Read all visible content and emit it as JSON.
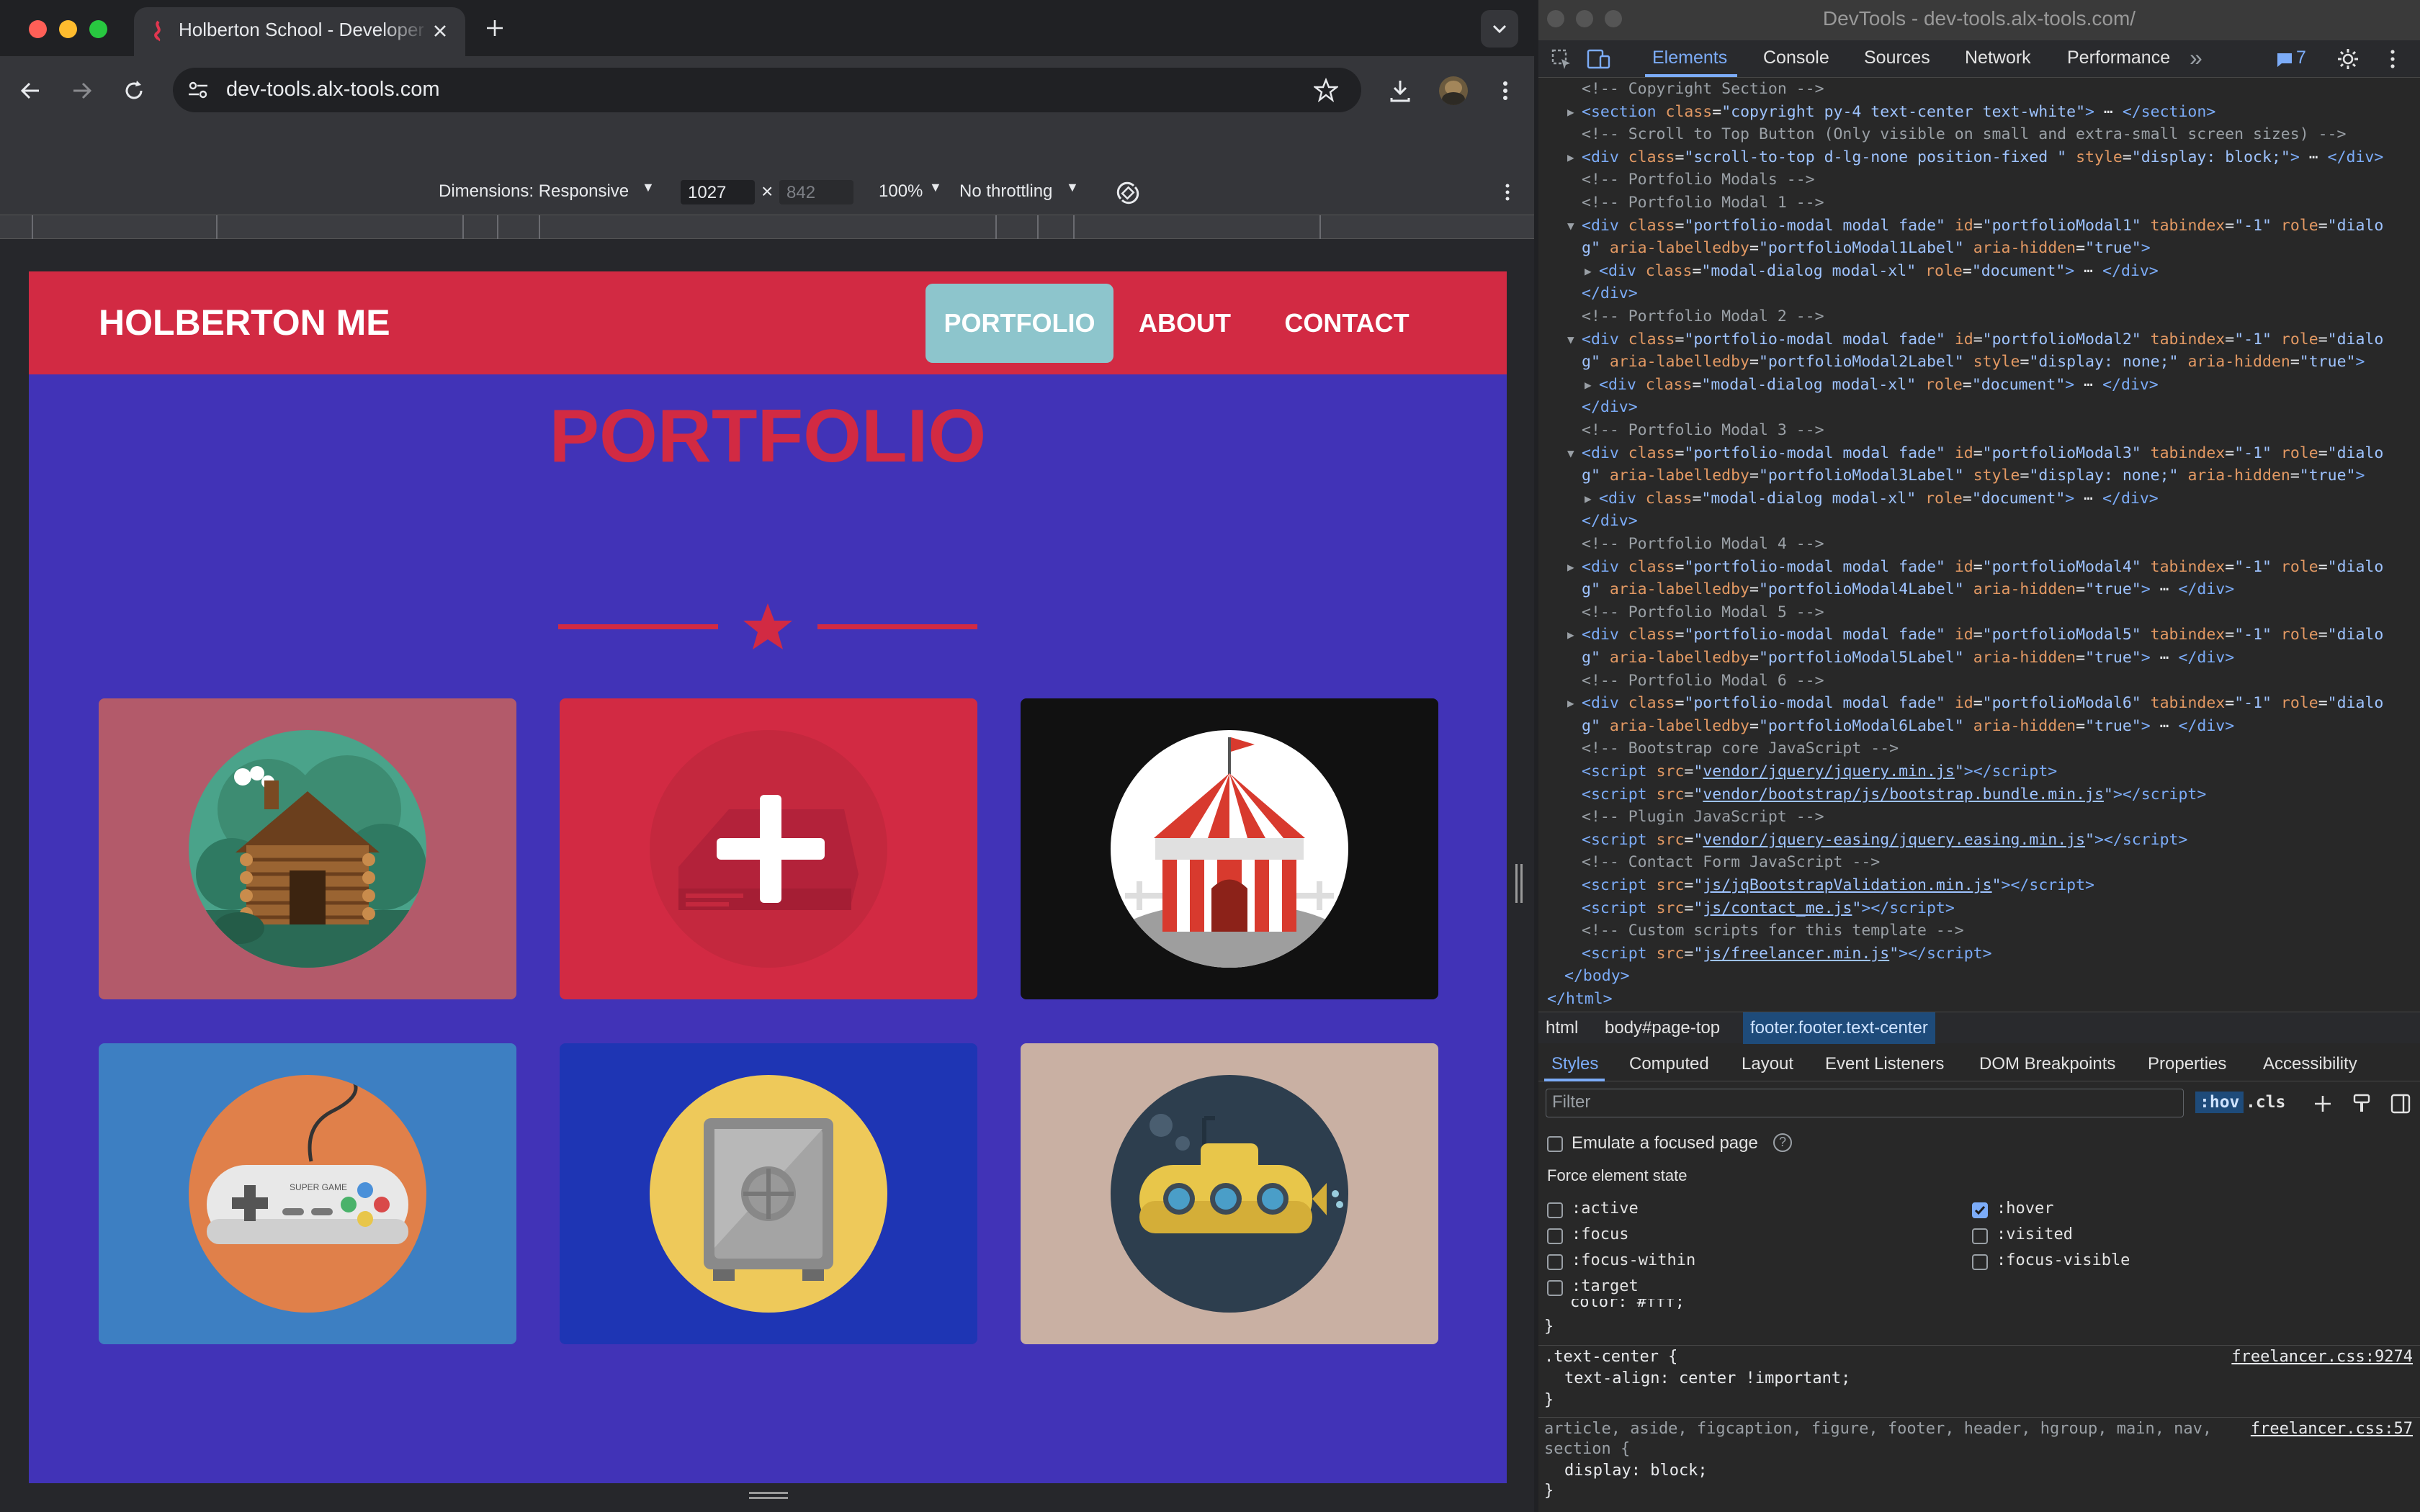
{
  "browser": {
    "tab_title": "Holberton School - Developer",
    "url": "dev-tools.alx-tools.com",
    "emulation": {
      "dimensions_label": "Dimensions: Responsive",
      "width": "1027",
      "times": "×",
      "height": "842",
      "zoom": "100%",
      "throttling": "No throttling"
    }
  },
  "site": {
    "brand": "HOLBERTON ME",
    "nav": [
      "PORTFOLIO",
      "ABOUT",
      "CONTACT"
    ],
    "section_title": "PORTFOLIO",
    "items": [
      {
        "icon": "cabin-icon",
        "bg": "#b35a6a"
      },
      {
        "icon": "life-saver-plus-icon",
        "bg": "#d22a43"
      },
      {
        "icon": "circus-tent-icon",
        "bg": "#111111"
      },
      {
        "icon": "game-controller-icon",
        "bg": "#3d7fc2"
      },
      {
        "icon": "safe-icon",
        "bg": "#1e35b4"
      },
      {
        "icon": "submarine-icon",
        "bg": "#c9b0a3"
      }
    ],
    "colors": {
      "primary": "#d22a43",
      "bg": "#4133b7",
      "nav_active": "#8dc5cc"
    }
  },
  "devtools": {
    "window_title": "DevTools - dev-tools.alx-tools.com/",
    "tabs": [
      "Elements",
      "Console",
      "Sources",
      "Network",
      "Performance"
    ],
    "issues_count": "7",
    "code_lines": [
      {
        "indent": 1,
        "arrow": "",
        "html": "<span class='cm'>&lt;!-- Copyright Section --&gt;</span>"
      },
      {
        "indent": 1,
        "arrow": "▶",
        "html": "<span class='tag'>&lt;section</span> <span class='an'>class</span>=<span class='av'>\"copyright py-4 text-center text-white\"</span><span class='tag'>&gt;</span> ⋯ <span class='tag'>&lt;/section&gt;</span>"
      },
      {
        "indent": 1,
        "arrow": "",
        "html": "<span class='cm'>&lt;!-- Scroll to Top Button (Only visible on small and extra-small screen sizes) --&gt;</span>"
      },
      {
        "indent": 1,
        "arrow": "▶",
        "html": "<span class='tag'>&lt;div</span> <span class='an'>class</span>=<span class='av'>\"scroll-to-top d-lg-none position-fixed \"</span> <span class='an'>style</span>=<span class='av'>\"display: block;\"</span><span class='tag'>&gt;</span> ⋯ <span class='tag'>&lt;/div&gt;</span>"
      },
      {
        "indent": 1,
        "arrow": "",
        "html": "<span class='cm'>&lt;!-- Portfolio Modals --&gt;</span>"
      },
      {
        "indent": 1,
        "arrow": "",
        "html": "<span class='cm'>&lt;!-- Portfolio Modal 1 --&gt;</span>"
      },
      {
        "indent": 1,
        "arrow": "▼",
        "html": "<span class='tag'>&lt;div</span> <span class='an'>class</span>=<span class='av'>\"portfolio-modal modal fade\"</span> <span class='an'>id</span>=<span class='av'>\"portfolioModal1\"</span> <span class='an'>tabindex</span>=<span class='av'>\"-1\"</span> <span class='an'>role</span>=<span class='av'>\"dialo</span>"
      },
      {
        "indent": 1,
        "arrow": "",
        "html": "<span class='av'>g\"</span> <span class='an'>aria-labelledby</span>=<span class='av'>\"portfolioModal1Label\"</span> <span class='an'>aria-hidden</span>=<span class='av'>\"true\"</span><span class='tag'>&gt;</span>"
      },
      {
        "indent": 2,
        "arrow": "▶",
        "html": "<span class='tag'>&lt;div</span> <span class='an'>class</span>=<span class='av'>\"modal-dialog modal-xl\"</span> <span class='an'>role</span>=<span class='av'>\"document\"</span><span class='tag'>&gt;</span> ⋯ <span class='tag'>&lt;/div&gt;</span>"
      },
      {
        "indent": 1,
        "arrow": "",
        "html": "<span class='tag'>&lt;/div&gt;</span>"
      },
      {
        "indent": 1,
        "arrow": "",
        "html": "<span class='cm'>&lt;!-- Portfolio Modal 2 --&gt;</span>"
      },
      {
        "indent": 1,
        "arrow": "▼",
        "html": "<span class='tag'>&lt;div</span> <span class='an'>class</span>=<span class='av'>\"portfolio-modal modal fade\"</span> <span class='an'>id</span>=<span class='av'>\"portfolioModal2\"</span> <span class='an'>tabindex</span>=<span class='av'>\"-1\"</span> <span class='an'>role</span>=<span class='av'>\"dialo</span>"
      },
      {
        "indent": 1,
        "arrow": "",
        "html": "<span class='av'>g\"</span> <span class='an'>aria-labelledby</span>=<span class='av'>\"portfolioModal2Label\"</span> <span class='an'>style</span>=<span class='av'>\"display: none;\"</span> <span class='an'>aria-hidden</span>=<span class='av'>\"true\"</span><span class='tag'>&gt;</span>"
      },
      {
        "indent": 2,
        "arrow": "▶",
        "html": "<span class='tag'>&lt;div</span> <span class='an'>class</span>=<span class='av'>\"modal-dialog modal-xl\"</span> <span class='an'>role</span>=<span class='av'>\"document\"</span><span class='tag'>&gt;</span> ⋯ <span class='tag'>&lt;/div&gt;</span>"
      },
      {
        "indent": 1,
        "arrow": "",
        "html": "<span class='tag'>&lt;/div&gt;</span>"
      },
      {
        "indent": 1,
        "arrow": "",
        "html": "<span class='cm'>&lt;!-- Portfolio Modal 3 --&gt;</span>"
      },
      {
        "indent": 1,
        "arrow": "▼",
        "html": "<span class='tag'>&lt;div</span> <span class='an'>class</span>=<span class='av'>\"portfolio-modal modal fade\"</span> <span class='an'>id</span>=<span class='av'>\"portfolioModal3\"</span> <span class='an'>tabindex</span>=<span class='av'>\"-1\"</span> <span class='an'>role</span>=<span class='av'>\"dialo</span>"
      },
      {
        "indent": 1,
        "arrow": "",
        "html": "<span class='av'>g\"</span> <span class='an'>aria-labelledby</span>=<span class='av'>\"portfolioModal3Label\"</span> <span class='an'>style</span>=<span class='av'>\"display: none;\"</span> <span class='an'>aria-hidden</span>=<span class='av'>\"true\"</span><span class='tag'>&gt;</span>"
      },
      {
        "indent": 2,
        "arrow": "▶",
        "html": "<span class='tag'>&lt;div</span> <span class='an'>class</span>=<span class='av'>\"modal-dialog modal-xl\"</span> <span class='an'>role</span>=<span class='av'>\"document\"</span><span class='tag'>&gt;</span> ⋯ <span class='tag'>&lt;/div&gt;</span>"
      },
      {
        "indent": 1,
        "arrow": "",
        "html": "<span class='tag'>&lt;/div&gt;</span>"
      },
      {
        "indent": 1,
        "arrow": "",
        "html": "<span class='cm'>&lt;!-- Portfolio Modal 4 --&gt;</span>"
      },
      {
        "indent": 1,
        "arrow": "▶",
        "html": "<span class='tag'>&lt;div</span> <span class='an'>class</span>=<span class='av'>\"portfolio-modal modal fade\"</span> <span class='an'>id</span>=<span class='av'>\"portfolioModal4\"</span> <span class='an'>tabindex</span>=<span class='av'>\"-1\"</span> <span class='an'>role</span>=<span class='av'>\"dialo</span>"
      },
      {
        "indent": 1,
        "arrow": "",
        "html": "<span class='av'>g\"</span> <span class='an'>aria-labelledby</span>=<span class='av'>\"portfolioModal4Label\"</span> <span class='an'>aria-hidden</span>=<span class='av'>\"true\"</span><span class='tag'>&gt;</span> ⋯ <span class='tag'>&lt;/div&gt;</span>"
      },
      {
        "indent": 1,
        "arrow": "",
        "html": "<span class='cm'>&lt;!-- Portfolio Modal 5 --&gt;</span>"
      },
      {
        "indent": 1,
        "arrow": "▶",
        "html": "<span class='tag'>&lt;div</span> <span class='an'>class</span>=<span class='av'>\"portfolio-modal modal fade\"</span> <span class='an'>id</span>=<span class='av'>\"portfolioModal5\"</span> <span class='an'>tabindex</span>=<span class='av'>\"-1\"</span> <span class='an'>role</span>=<span class='av'>\"dialo</span>"
      },
      {
        "indent": 1,
        "arrow": "",
        "html": "<span class='av'>g\"</span> <span class='an'>aria-labelledby</span>=<span class='av'>\"portfolioModal5Label\"</span> <span class='an'>aria-hidden</span>=<span class='av'>\"true\"</span><span class='tag'>&gt;</span> ⋯ <span class='tag'>&lt;/div&gt;</span>"
      },
      {
        "indent": 1,
        "arrow": "",
        "html": "<span class='cm'>&lt;!-- Portfolio Modal 6 --&gt;</span>"
      },
      {
        "indent": 1,
        "arrow": "▶",
        "html": "<span class='tag'>&lt;div</span> <span class='an'>class</span>=<span class='av'>\"portfolio-modal modal fade\"</span> <span class='an'>id</span>=<span class='av'>\"portfolioModal6\"</span> <span class='an'>tabindex</span>=<span class='av'>\"-1\"</span> <span class='an'>role</span>=<span class='av'>\"dialo</span>"
      },
      {
        "indent": 1,
        "arrow": "",
        "html": "<span class='av'>g\"</span> <span class='an'>aria-labelledby</span>=<span class='av'>\"portfolioModal6Label\"</span> <span class='an'>aria-hidden</span>=<span class='av'>\"true\"</span><span class='tag'>&gt;</span> ⋯ <span class='tag'>&lt;/div&gt;</span>"
      },
      {
        "indent": 1,
        "arrow": "",
        "html": "<span class='cm'>&lt;!-- Bootstrap core JavaScript --&gt;</span>"
      },
      {
        "indent": 1,
        "arrow": "",
        "html": "<span class='tag'>&lt;script</span> <span class='an'>src</span>=<span class='av'>\"</span><span class='lk'>vendor/jquery/jquery.min.js</span><span class='av'>\"</span><span class='tag'>&gt;&lt;/script&gt;</span>"
      },
      {
        "indent": 1,
        "arrow": "",
        "html": "<span class='tag'>&lt;script</span> <span class='an'>src</span>=<span class='av'>\"</span><span class='lk'>vendor/bootstrap/js/bootstrap.bundle.min.js</span><span class='av'>\"</span><span class='tag'>&gt;&lt;/script&gt;</span>"
      },
      {
        "indent": 1,
        "arrow": "",
        "html": "<span class='cm'>&lt;!-- Plugin JavaScript --&gt;</span>"
      },
      {
        "indent": 1,
        "arrow": "",
        "html": "<span class='tag'>&lt;script</span> <span class='an'>src</span>=<span class='av'>\"</span><span class='lk'>vendor/jquery-easing/jquery.easing.min.js</span><span class='av'>\"</span><span class='tag'>&gt;&lt;/script&gt;</span>"
      },
      {
        "indent": 1,
        "arrow": "",
        "html": "<span class='cm'>&lt;!-- Contact Form JavaScript --&gt;</span>"
      },
      {
        "indent": 1,
        "arrow": "",
        "html": "<span class='tag'>&lt;script</span> <span class='an'>src</span>=<span class='av'>\"</span><span class='lk'>js/jqBootstrapValidation.min.js</span><span class='av'>\"</span><span class='tag'>&gt;&lt;/script&gt;</span>"
      },
      {
        "indent": 1,
        "arrow": "",
        "html": "<span class='tag'>&lt;script</span> <span class='an'>src</span>=<span class='av'>\"</span><span class='lk'>js/contact_me.js</span><span class='av'>\"</span><span class='tag'>&gt;&lt;/script&gt;</span>"
      },
      {
        "indent": 1,
        "arrow": "",
        "html": "<span class='cm'>&lt;!-- Custom scripts for this template --&gt;</span>"
      },
      {
        "indent": 1,
        "arrow": "",
        "html": "<span class='tag'>&lt;script</span> <span class='an'>src</span>=<span class='av'>\"</span><span class='lk'>js/freelancer.min.js</span><span class='av'>\"</span><span class='tag'>&gt;&lt;/script&gt;</span>"
      },
      {
        "indent": 0,
        "arrow": "",
        "html": "<span class='tag'>&lt;/body&gt;</span>"
      },
      {
        "indent": -1,
        "arrow": "",
        "html": "<span class='tag'>&lt;/html&gt;</span>"
      }
    ],
    "breadcrumbs": [
      "html",
      "body#page-top",
      "footer.footer.text-center"
    ],
    "style_tabs": [
      "Styles",
      "Computed",
      "Layout",
      "Event Listeners",
      "DOM Breakpoints",
      "Properties",
      "Accessibility"
    ],
    "filter_placeholder": "Filter",
    "hov": ":hov",
    "cls": ".cls",
    "emulate_focus_label": "Emulate a focused page",
    "force_state_label": "Force element state",
    "states_left": [
      ":active",
      ":focus",
      ":focus-within",
      ":target"
    ],
    "states_right": [
      ":hover",
      ":visited",
      ":focus-visible"
    ],
    "hover_checked": true,
    "color_rule": "color: #fff;",
    "rule1_selector": ".text-center {",
    "rule1_prop": "text-align: center !important;",
    "rule1_src": "freelancer.css:9274",
    "rule2_selector": "article, aside, figcaption, figure, footer, header, hgroup, main, nav,",
    "rule2_selector2": "section {",
    "rule2_prop": "display: block;",
    "rule2_src": "freelancer.css:57",
    "close_brace": "}"
  }
}
